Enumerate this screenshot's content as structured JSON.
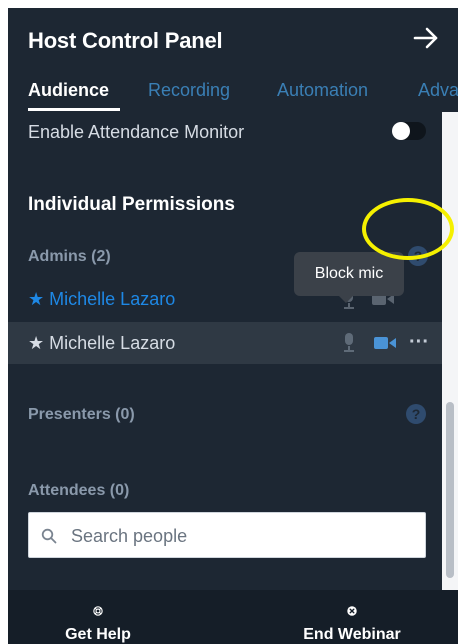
{
  "header": {
    "title": "Host Control Panel",
    "collapse_icon": "arrow-right-icon"
  },
  "tabs": [
    {
      "label": "Audience",
      "active": true
    },
    {
      "label": "Recording",
      "active": false
    },
    {
      "label": "Automation",
      "active": false
    },
    {
      "label": "Adva",
      "active": false
    }
  ],
  "settings": {
    "attendance_monitor_label": "Enable Attendance Monitor",
    "attendance_monitor_enabled": false
  },
  "permissions": {
    "title": "Individual Permissions",
    "admins_label": "Admins (2)",
    "admins": [
      {
        "name": "Michelle Lazaro",
        "star": "★",
        "highlighted": true
      },
      {
        "name": "Michelle Lazaro",
        "star": "★",
        "highlighted": false
      }
    ],
    "presenters_label": "Presenters (0)",
    "attendees_label": "Attendees (0)",
    "help_glyph": "?"
  },
  "tooltip": {
    "text": "Block mic"
  },
  "row_actions": {
    "more_glyph": "···"
  },
  "search": {
    "placeholder": "Search people"
  },
  "footer": {
    "get_help_label": "Get Help",
    "end_webinar_label": "End Webinar"
  },
  "colors": {
    "panel_bg": "#1d2733",
    "accent_blue": "#1e88e5",
    "highlight_ring": "#f5f000"
  }
}
